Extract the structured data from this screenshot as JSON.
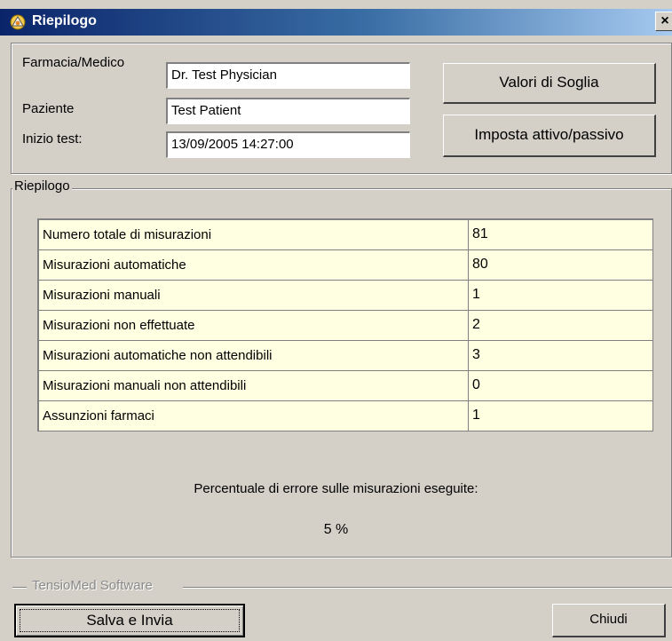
{
  "window": {
    "title": "Riepilogo",
    "close_glyph": "×",
    "icon": "app-flower-icon"
  },
  "info": {
    "pharmacy_label": "Farmacia/Medico",
    "pharmacy_value": "Dr. Test Physician",
    "patient_label": "Paziente",
    "patient_value": "Test Patient",
    "start_label": "Inizio test:",
    "start_value": "13/09/2005 14:27:00"
  },
  "buttons": {
    "thresholds": "Valori di Soglia",
    "active_passive": "Imposta attivo/passivo",
    "save_send": "Salva e Invia",
    "close": "Chiudi"
  },
  "summary": {
    "group_title": "Riepilogo",
    "rows": [
      {
        "label": "Numero totale di misurazioni",
        "value": "81"
      },
      {
        "label": "Misurazioni automatiche",
        "value": "80"
      },
      {
        "label": "Misurazioni manuali",
        "value": "1"
      },
      {
        "label": "Misurazioni non effettuate",
        "value": "2"
      },
      {
        "label": "Misurazioni automatiche non attendibili",
        "value": "3"
      },
      {
        "label": "Misurazioni manuali non attendibili",
        "value": "0"
      },
      {
        "label": "Assunzioni farmaci",
        "value": "1"
      }
    ],
    "error_caption": "Percentuale di errore sulle misurazioni eseguite:",
    "error_value": "5 %"
  },
  "footer": {
    "brand": "TensioMed Software"
  },
  "colors": {
    "dialog_bg": "#d4d0c8",
    "table_bg": "#ffffe1",
    "title_gradient_start": "#0a246a",
    "title_gradient_end": "#a6caf0"
  }
}
